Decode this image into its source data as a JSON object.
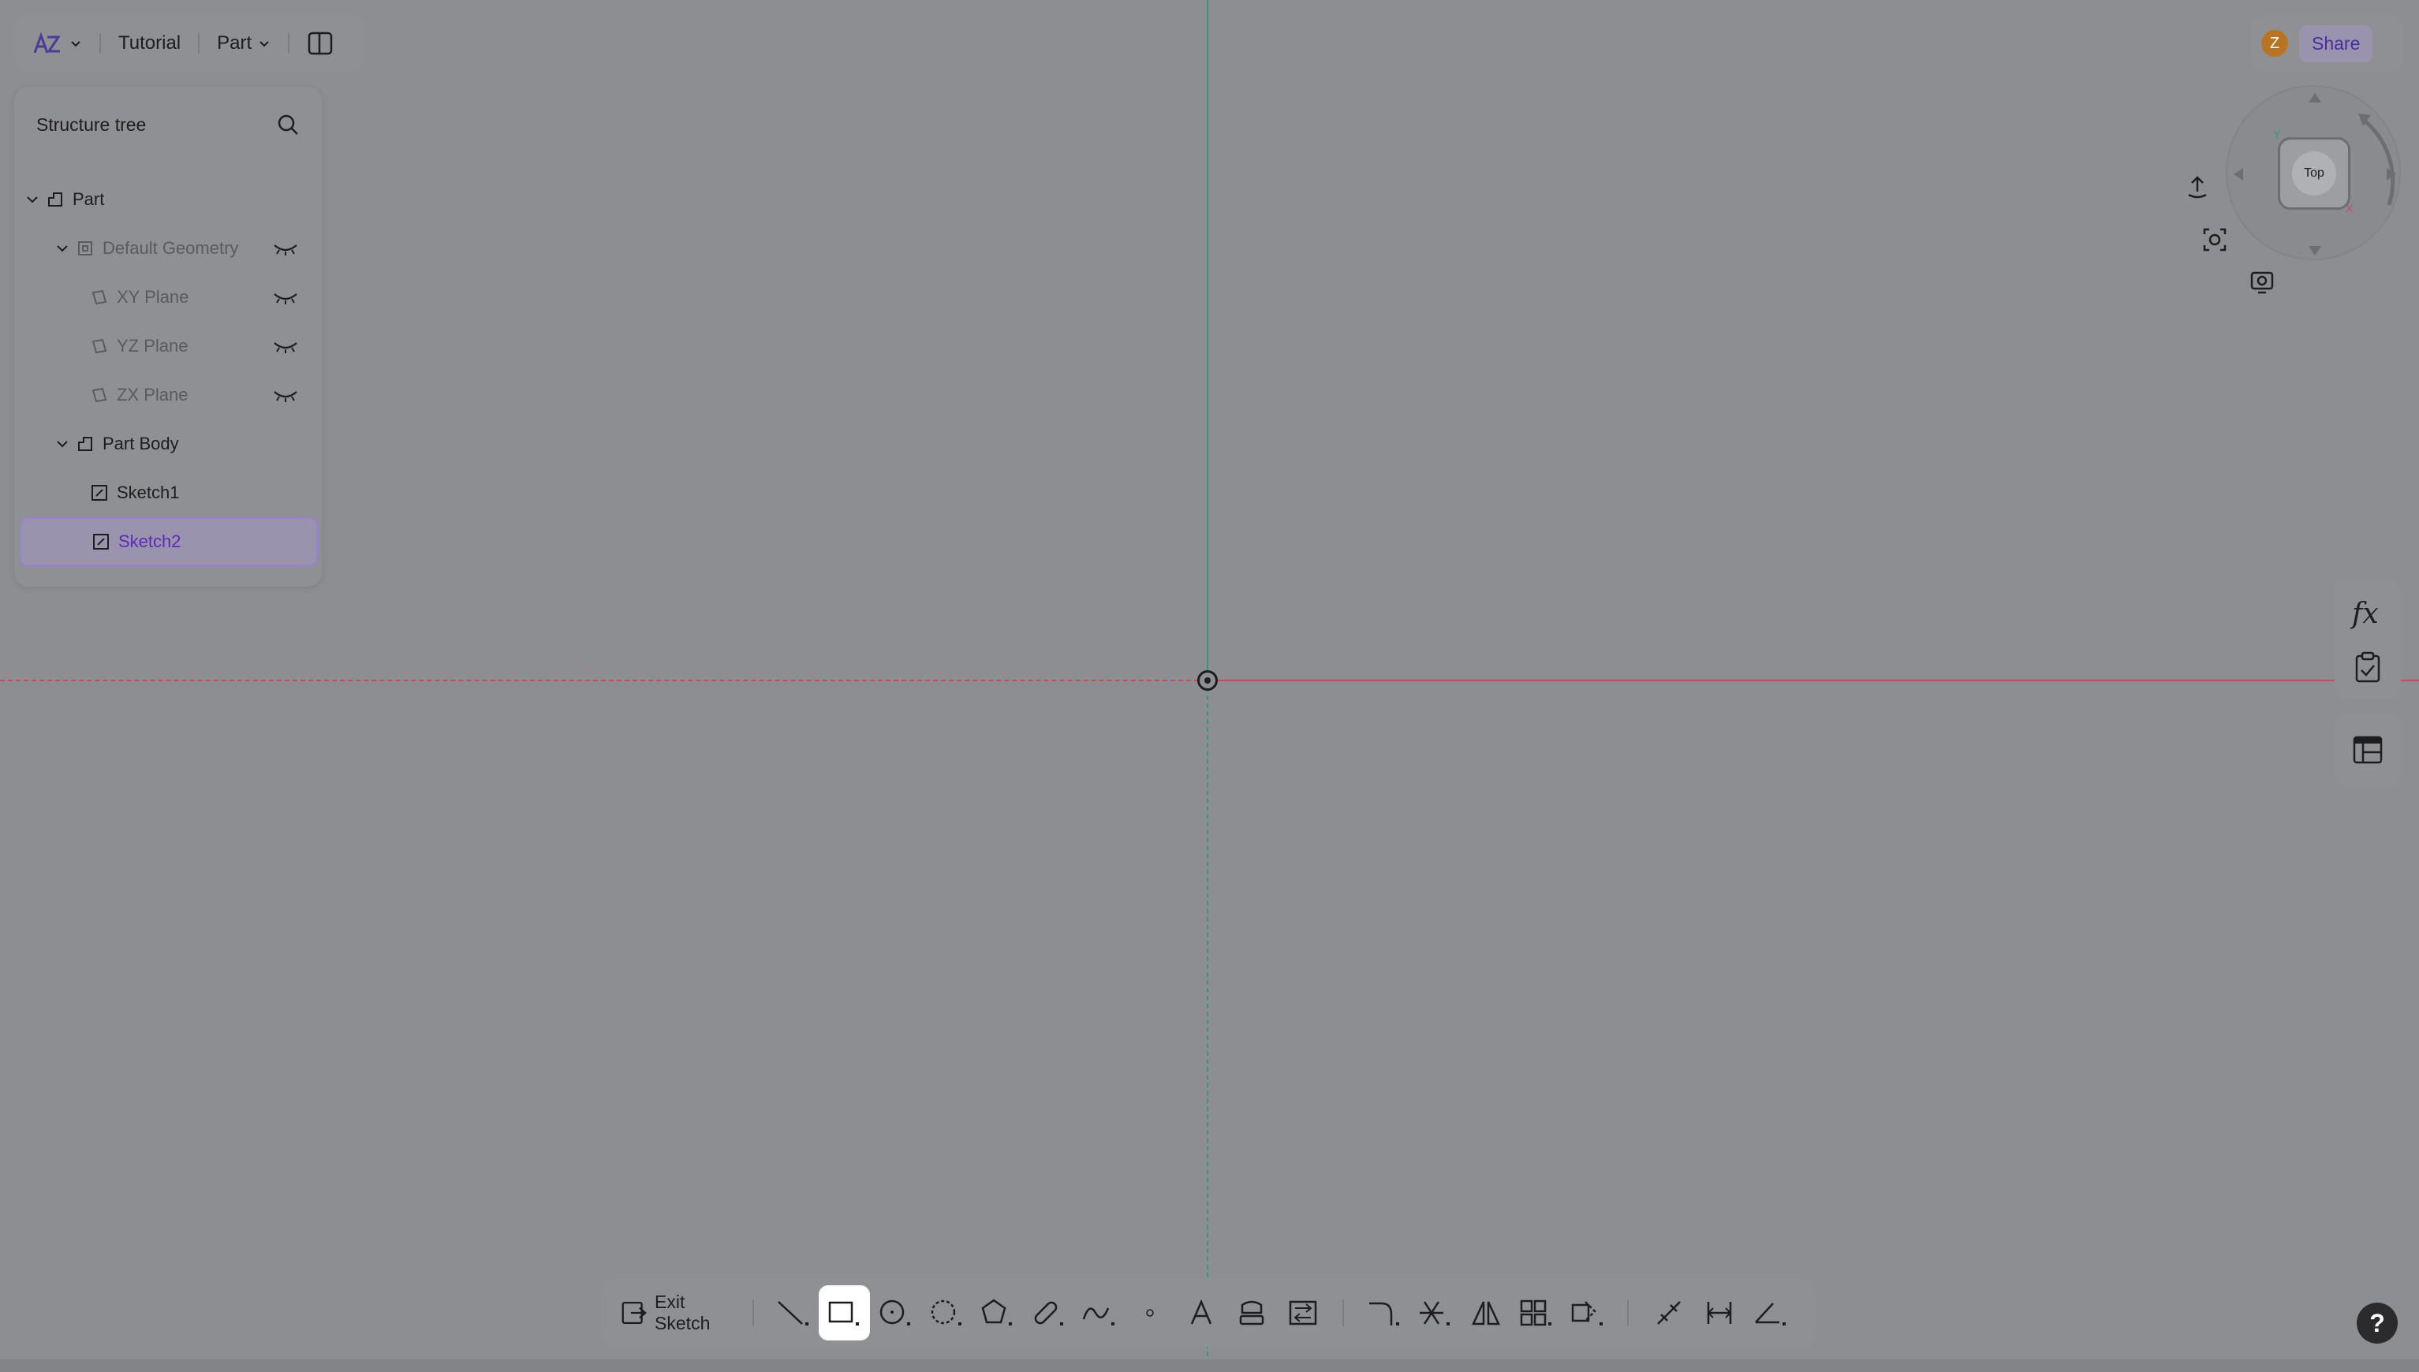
{
  "topbar": {
    "project": "Tutorial",
    "mode": "Part"
  },
  "tree": {
    "title": "Structure tree",
    "items": [
      {
        "label": "Part"
      },
      {
        "label": "Default Geometry"
      },
      {
        "label": "XY Plane"
      },
      {
        "label": "YZ Plane"
      },
      {
        "label": "ZX Plane"
      },
      {
        "label": "Part Body"
      },
      {
        "label": "Sketch1"
      },
      {
        "label": "Sketch2"
      }
    ]
  },
  "header_right": {
    "avatar_initial": "Z",
    "share_label": "Share"
  },
  "viewcube": {
    "face_label": "Top",
    "axis_x": "X",
    "axis_y": "Y"
  },
  "side_tools": {
    "fx_label": "fx"
  },
  "bottom_toolbar": {
    "exit_label": "Exit Sketch",
    "active_tool": "rectangle"
  },
  "help": {
    "label": "?"
  },
  "colors": {
    "x_axis": "#c94b5d",
    "y_axis": "#2f9b7e",
    "accent": "#5b2bb8"
  }
}
